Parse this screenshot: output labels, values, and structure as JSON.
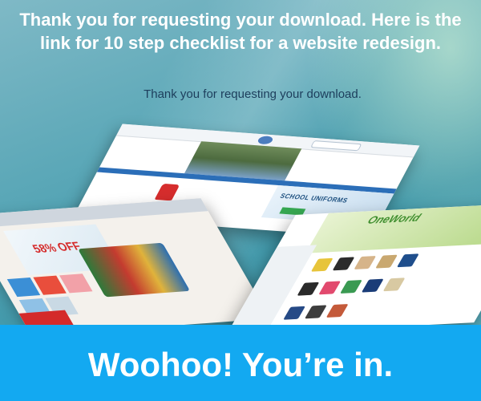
{
  "hero": {
    "headline": "Thank you for requesting your download. Here is the link for 10 step checklist for a website redesign.",
    "subline": "Thank you for requesting your download."
  },
  "mockups": {
    "school_banner": "SCHOOL UNIFORMS",
    "shop_sale": "58% OFF",
    "bags_logo": "OneWorld"
  },
  "band": {
    "text": "Woohoo! You’re in."
  },
  "colors": {
    "band_blue": "#13a9f1",
    "headline": "#ffffff",
    "subline": "#1d3e5c"
  }
}
